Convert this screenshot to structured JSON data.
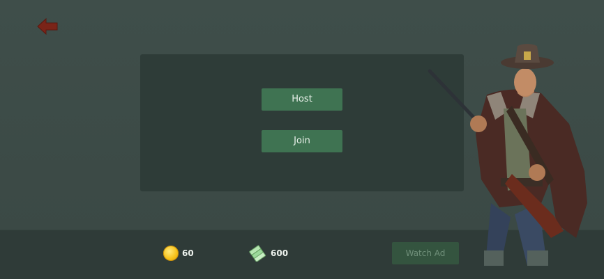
{
  "header": {
    "back_icon": "arrow-left-icon"
  },
  "menu": {
    "host_label": "Host",
    "join_label": "Join"
  },
  "footer": {
    "coins": {
      "icon": "coin-icon",
      "value": "60"
    },
    "cash": {
      "icon": "cash-stack-icon",
      "value": "600"
    },
    "watch_ad_label": "Watch Ad"
  },
  "colors": {
    "background": "#3b4a46",
    "panel": "#2e3c38",
    "button": "#3f7352",
    "button_disabled": "#34543f",
    "back_arrow": "#7a2418",
    "coin": "#f6c21a",
    "cash": "#9bd99a"
  }
}
